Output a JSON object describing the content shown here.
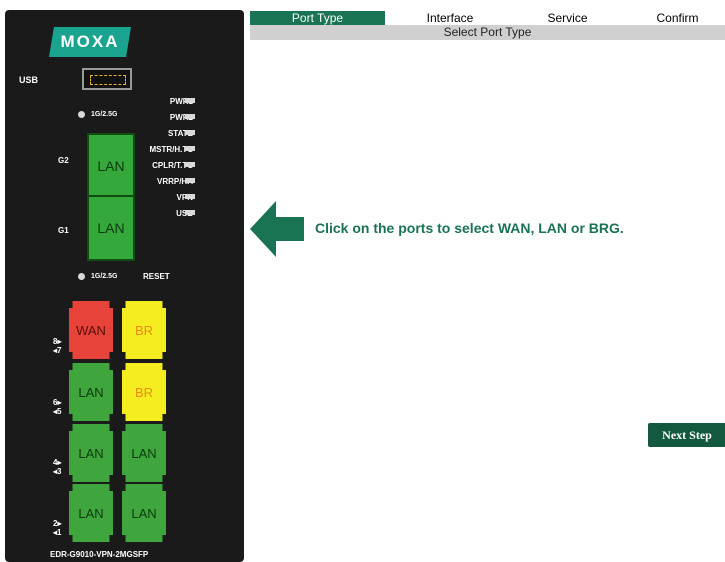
{
  "wizard": {
    "tabs": [
      {
        "label": "Port Type",
        "active": true
      },
      {
        "label": "Interface",
        "active": false
      },
      {
        "label": "Service",
        "active": false
      },
      {
        "label": "Confirm",
        "active": false
      }
    ],
    "subheader": "Select Port Type",
    "instruction": "Click on the ports to select WAN, LAN or BRG.",
    "next_button": "Next Step",
    "accent_color": "#1a7353"
  },
  "device": {
    "logo": "MOXA",
    "usb_label": "USB",
    "speed_label_top": "1G/2.5G",
    "speed_label_bottom": "1G/2.5G",
    "reset_label": "RESET",
    "model": "EDR-G9010-VPN-2MGSFP",
    "leds": [
      "PWR1",
      "PWR2",
      "STATE",
      "MSTR/H.TC",
      "CPLR/T.TC",
      "VRRP/HA",
      "VPN",
      "USB"
    ],
    "gig_ports": [
      {
        "name": "G2",
        "type": "LAN"
      },
      {
        "name": "G1",
        "type": "LAN"
      }
    ],
    "port_pairs": [
      {
        "top": "8▸",
        "bottom": "◂7",
        "left": "WAN",
        "right": "BR"
      },
      {
        "top": "6▸",
        "bottom": "◂5",
        "left": "LAN",
        "right": "BR"
      },
      {
        "top": "4▸",
        "bottom": "◂3",
        "left": "LAN",
        "right": "LAN"
      },
      {
        "top": "2▸",
        "bottom": "◂1",
        "left": "LAN",
        "right": "LAN"
      }
    ]
  }
}
